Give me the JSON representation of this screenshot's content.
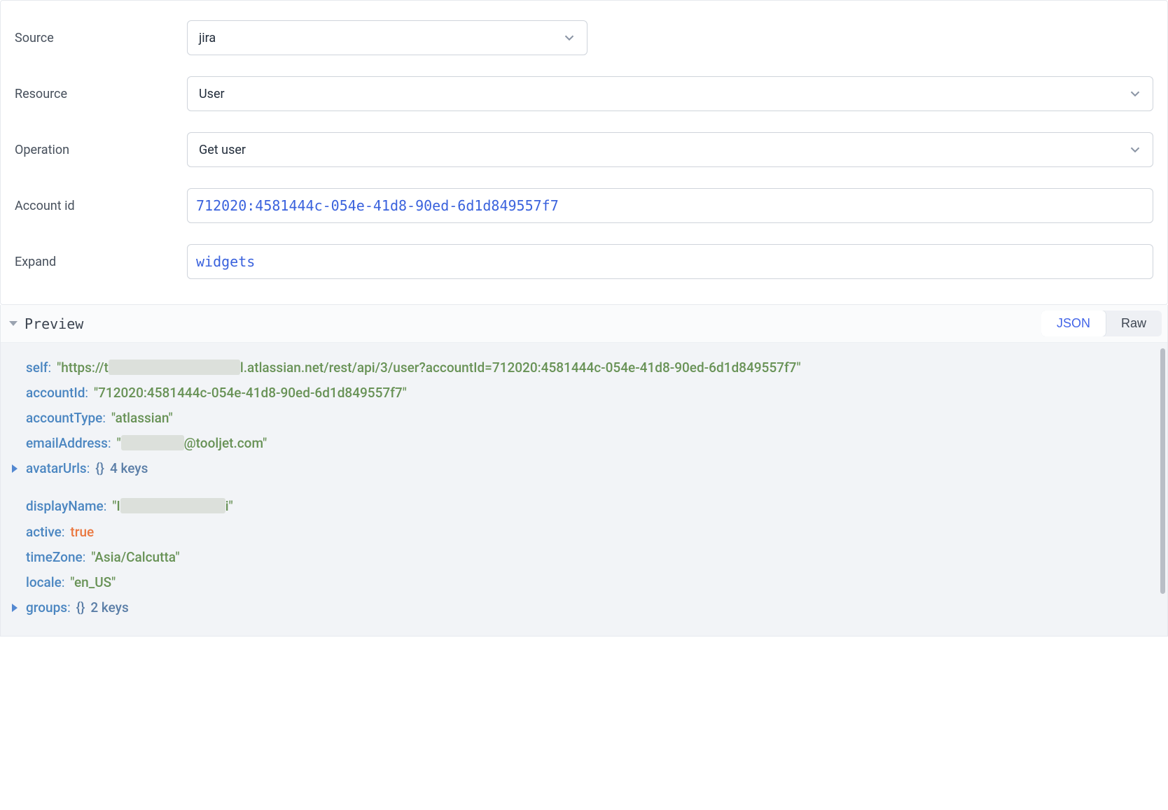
{
  "form": {
    "source": {
      "label": "Source",
      "value": "jira"
    },
    "resource": {
      "label": "Resource",
      "value": "User"
    },
    "operation": {
      "label": "Operation",
      "value": "Get user"
    },
    "account_id": {
      "label": "Account id",
      "value": "712020:4581444c-054e-41d8-90ed-6d1d849557f7"
    },
    "expand": {
      "label": "Expand",
      "value": "widgets"
    }
  },
  "preview": {
    "title": "Preview",
    "tabs": {
      "json": "JSON",
      "raw": "Raw"
    }
  },
  "json_response": {
    "self": {
      "key": "self",
      "prefix": "\"https://t",
      "suffix": "l.atlassian.net/rest/api/3/user?accountId=712020:4581444c-054e-41d8-90ed-6d1d849557f7\""
    },
    "accountId": {
      "key": "accountId",
      "value": "\"712020:4581444c-054e-41d8-90ed-6d1d849557f7\""
    },
    "accountType": {
      "key": "accountType",
      "value": "\"atlassian\""
    },
    "emailAddress": {
      "key": "emailAddress",
      "prefix": "\"",
      "suffix": "@tooljet.com\""
    },
    "avatarUrls": {
      "key": "avatarUrls",
      "braces": "{}",
      "summary": "4 keys"
    },
    "displayName": {
      "key": "displayName",
      "prefix": "\"I",
      "suffix": "i\""
    },
    "active": {
      "key": "active",
      "value": "true"
    },
    "timeZone": {
      "key": "timeZone",
      "value": "\"Asia/Calcutta\""
    },
    "locale": {
      "key": "locale",
      "value": "\"en_US\""
    },
    "groups": {
      "key": "groups",
      "braces": "{}",
      "summary": "2 keys"
    }
  }
}
